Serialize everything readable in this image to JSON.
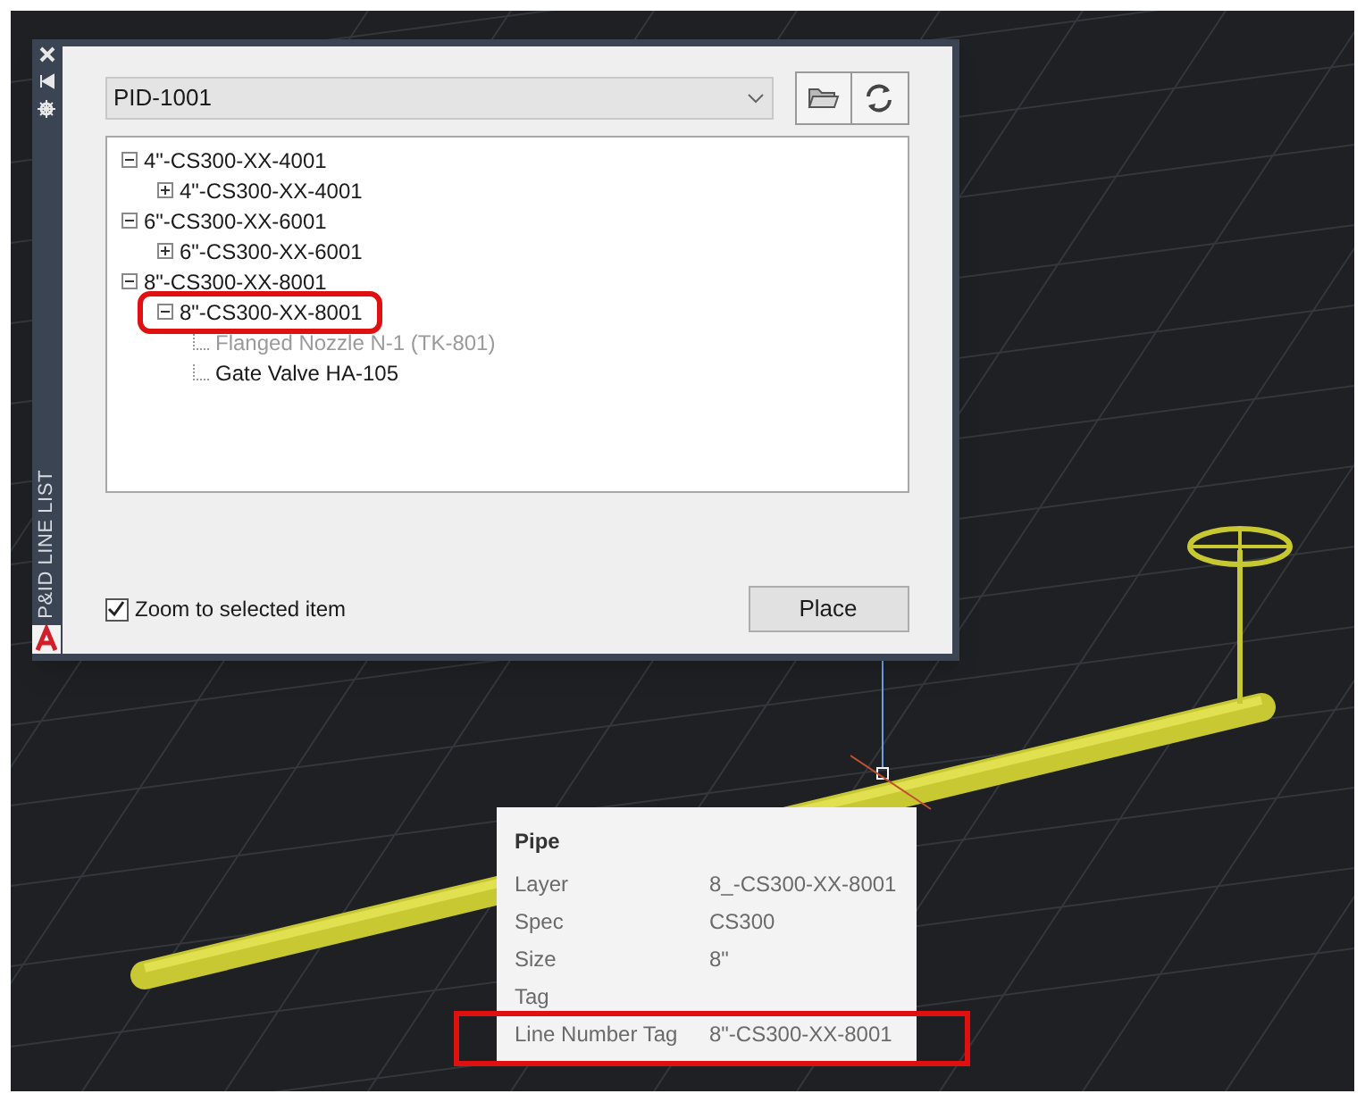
{
  "palette": {
    "title": "P&ID LINE LIST",
    "drawing_dropdown": {
      "value": "PID-1001"
    },
    "tree": [
      {
        "label": "4\"-CS300-XX-4001",
        "expanded": true,
        "dimmed": false,
        "annotated": false,
        "children": [
          {
            "label": "4\"-CS300-XX-4001",
            "expanded": false,
            "dimmed": false,
            "annotated": false
          }
        ]
      },
      {
        "label": "6\"-CS300-XX-6001",
        "expanded": true,
        "dimmed": false,
        "annotated": false,
        "children": [
          {
            "label": "6\"-CS300-XX-6001",
            "expanded": false,
            "dimmed": false,
            "annotated": false
          }
        ]
      },
      {
        "label": "8\"-CS300-XX-8001",
        "expanded": true,
        "dimmed": false,
        "annotated": false,
        "children": [
          {
            "label": "8\"-CS300-XX-8001",
            "expanded": true,
            "dimmed": false,
            "annotated": true,
            "children": [
              {
                "label": "Flanged Nozzle N-1 (TK-801)",
                "dimmed": true,
                "annotated": false
              },
              {
                "label": "Gate Valve HA-105",
                "dimmed": false,
                "annotated": false
              }
            ]
          }
        ]
      }
    ],
    "zoom_checkbox": {
      "label": "Zoom to selected item",
      "checked": true
    },
    "place_button": "Place"
  },
  "tooltip": {
    "title": "Pipe",
    "rows": [
      {
        "label": "Layer",
        "value": "8_-CS300-XX-8001",
        "annotated": false
      },
      {
        "label": "Spec",
        "value": "CS300",
        "annotated": false
      },
      {
        "label": "Size",
        "value": "8\"",
        "annotated": false
      },
      {
        "label": "Tag",
        "annotated": false
      },
      {
        "label": "Line Number Tag",
        "value": "8\"-CS300-XX-8001",
        "annotated": true
      }
    ]
  }
}
